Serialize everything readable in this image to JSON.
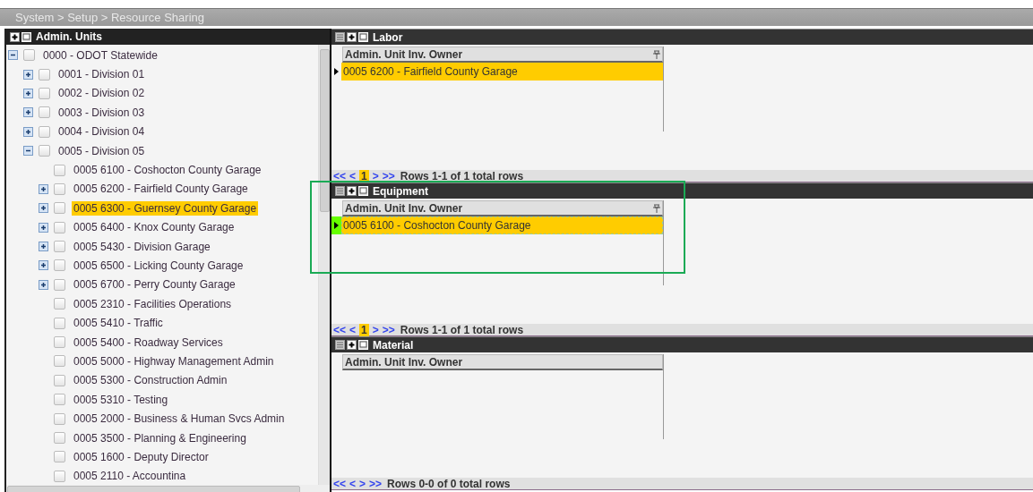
{
  "breadcrumb": "System > Setup > Resource Sharing",
  "tree": {
    "title": "Admin. Units",
    "items": [
      {
        "label": "0000 - ODOT Statewide",
        "kind": "branch",
        "expanded": true,
        "checked": false,
        "selected": false,
        "children": [
          {
            "label": "0001 - Division 01",
            "kind": "branch",
            "expanded": false,
            "checked": false,
            "selected": false
          },
          {
            "label": "0002 - Division 02",
            "kind": "branch",
            "expanded": false,
            "checked": false,
            "selected": false
          },
          {
            "label": "0003 - Division 03",
            "kind": "branch",
            "expanded": false,
            "checked": false,
            "selected": false
          },
          {
            "label": "0004 - Division 04",
            "kind": "branch",
            "expanded": false,
            "checked": false,
            "selected": false
          },
          {
            "label": "0005 - Division 05",
            "kind": "branch",
            "expanded": true,
            "checked": false,
            "selected": false,
            "children": [
              {
                "label": "0005 6100 - Coshocton County Garage",
                "kind": "leaf",
                "checked": false,
                "selected": false
              },
              {
                "label": "0005 6200 - Fairfield County Garage",
                "kind": "branch",
                "expanded": false,
                "checked": false,
                "selected": false
              },
              {
                "label": "0005 6300 - Guernsey County Garage",
                "kind": "branch",
                "expanded": false,
                "checked": false,
                "selected": true
              },
              {
                "label": "0005 6400 - Knox County Garage",
                "kind": "branch",
                "expanded": false,
                "checked": false,
                "selected": false
              },
              {
                "label": "0005 5430 - Division Garage",
                "kind": "branch",
                "expanded": false,
                "checked": false,
                "selected": false
              },
              {
                "label": "0005 6500 - Licking County Garage",
                "kind": "branch",
                "expanded": false,
                "checked": false,
                "selected": false
              },
              {
                "label": "0005 6700 - Perry County Garage",
                "kind": "branch",
                "expanded": false,
                "checked": false,
                "selected": false
              },
              {
                "label": "0005 2310 - Facilities Operations",
                "kind": "leaf",
                "checked": false,
                "selected": false
              },
              {
                "label": "0005 5410 - Traffic",
                "kind": "leaf",
                "checked": false,
                "selected": false
              },
              {
                "label": "0005 5400 - Roadway Services",
                "kind": "leaf",
                "checked": false,
                "selected": false
              },
              {
                "label": "0005 5000 - Highway Management Admin",
                "kind": "leaf",
                "checked": false,
                "selected": false
              },
              {
                "label": "0005 5300 - Construction Admin",
                "kind": "leaf",
                "checked": false,
                "selected": false
              },
              {
                "label": "0005 5310 - Testing",
                "kind": "leaf",
                "checked": false,
                "selected": false
              },
              {
                "label": "0005 2000 - Business & Human Svcs Admin",
                "kind": "leaf",
                "checked": false,
                "selected": false
              },
              {
                "label": "0005 3500 - Planning & Engineering",
                "kind": "leaf",
                "checked": false,
                "selected": false
              },
              {
                "label": "0005 1600 - Deputy Director",
                "kind": "leaf",
                "checked": false,
                "selected": false
              },
              {
                "label": "0005 2110 - Accountina",
                "kind": "leaf",
                "checked": false,
                "selected": false
              }
            ]
          }
        ]
      }
    ]
  },
  "panes": [
    {
      "title": "Labor",
      "column": "Admin. Unit Inv. Owner",
      "sort_icon": true,
      "rows": [
        {
          "text": "0005 6200 - Fairfield County Garage",
          "selected": true,
          "focused": false
        }
      ],
      "pager": {
        "first": "<<",
        "prev": "<",
        "pages": [
          {
            "label": "1",
            "selected": true
          }
        ],
        "next": ">",
        "last": ">>",
        "summary": "Rows 1-1 of 1 total rows"
      }
    },
    {
      "title": "Equipment",
      "column": "Admin. Unit Inv. Owner",
      "sort_icon": true,
      "rows": [
        {
          "text": "0005 6100 - Coshocton County Garage",
          "selected": true,
          "focused": true
        }
      ],
      "pager": {
        "first": "<<",
        "prev": "<",
        "pages": [
          {
            "label": "1",
            "selected": true
          }
        ],
        "next": ">",
        "last": ">>",
        "summary": "Rows 1-1 of 1 total rows"
      }
    },
    {
      "title": "Material",
      "column": "Admin. Unit Inv. Owner",
      "sort_icon": false,
      "pager": {
        "first": "<<",
        "prev": "<",
        "next": ">",
        "last": ">>",
        "summary": "Rows 0-0 of 0 total rows"
      }
    }
  ]
}
